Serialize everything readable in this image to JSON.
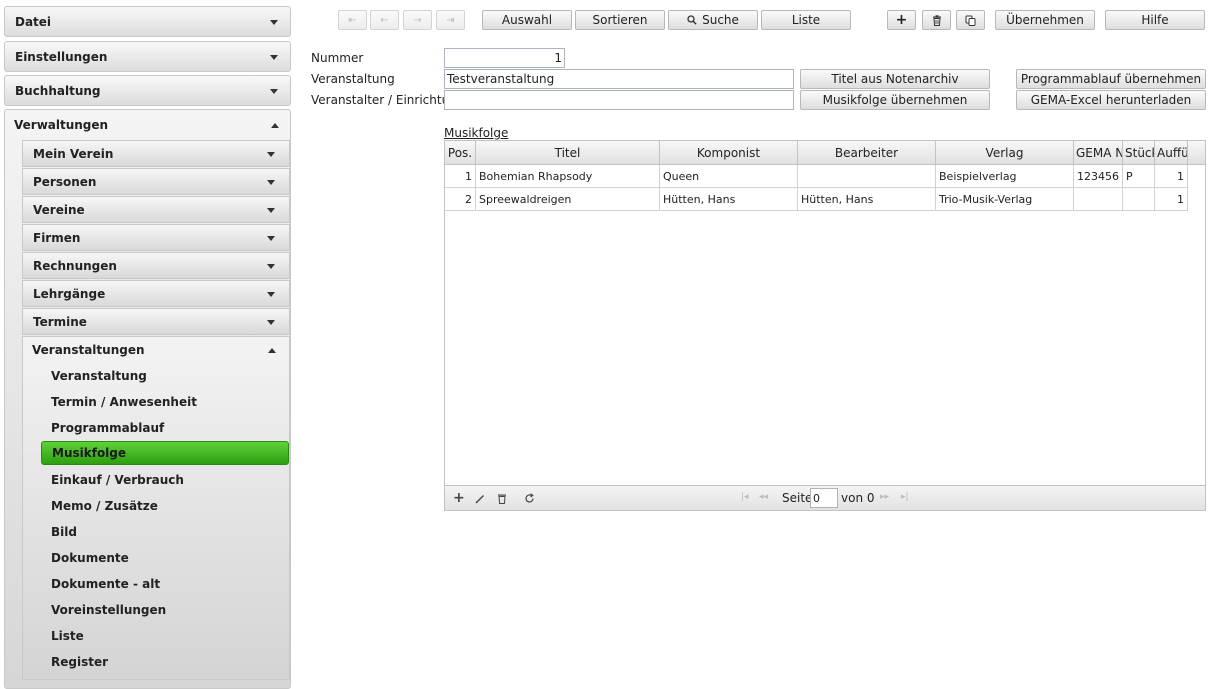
{
  "sidebar": {
    "top": [
      {
        "label": "Datei"
      },
      {
        "label": "Einstellungen"
      },
      {
        "label": "Buchhaltung"
      },
      {
        "label": "Verwaltungen"
      }
    ],
    "verwaltungen_items": [
      {
        "label": "Mein Verein"
      },
      {
        "label": "Personen"
      },
      {
        "label": "Vereine"
      },
      {
        "label": "Firmen"
      },
      {
        "label": "Rechnungen"
      },
      {
        "label": "Lehrgänge"
      },
      {
        "label": "Termine"
      },
      {
        "label": "Veranstaltungen"
      }
    ],
    "veranstaltungen_items": [
      {
        "label": "Veranstaltung"
      },
      {
        "label": "Termin / Anwesenheit"
      },
      {
        "label": "Programmablauf"
      },
      {
        "label": "Musikfolge"
      },
      {
        "label": "Einkauf / Verbrauch"
      },
      {
        "label": "Memo / Zusätze"
      },
      {
        "label": "Bild"
      },
      {
        "label": "Dokumente"
      },
      {
        "label": "Dokumente - alt"
      },
      {
        "label": "Voreinstellungen"
      },
      {
        "label": "Liste"
      },
      {
        "label": "Register"
      }
    ],
    "active_item": "Musikfolge",
    "active_color": "#3fb31f"
  },
  "toolbar": {
    "nav": {
      "first": "⇤",
      "prev": "←",
      "next": "→",
      "last": "⇥"
    },
    "auswahl": "Auswahl",
    "sortieren": "Sortieren",
    "suche": "Suche",
    "liste": "Liste",
    "add": "+",
    "uebernehmen": "Übernehmen",
    "hilfe": "Hilfe"
  },
  "form": {
    "nummer_label": "Nummer",
    "nummer_value": "1",
    "veranstaltung_label": "Veranstaltung",
    "veranstaltung_value": "Testveranstaltung",
    "veranstalter_label": "Veranstalter / Einrichtung",
    "veranstalter_value": "",
    "titel_notenarchiv": "Titel aus Notenarchiv",
    "musikfolge_uebernehmen": "Musikfolge übernehmen",
    "programmablauf_uebernehmen": "Programmablauf übernehmen",
    "gema_excel": "GEMA-Excel herunterladen"
  },
  "grid": {
    "title": "Musikfolge",
    "columns": [
      "Pos.",
      "Titel",
      "Komponist",
      "Bearbeiter",
      "Verlag",
      "GEMA N",
      "Stück",
      "Auffü"
    ],
    "rows": [
      {
        "pos": "1",
        "titel": "Bohemian Rhapsody",
        "komponist": "Queen",
        "bearbeiter": "",
        "verlag": "Beispielverlag",
        "gema": "123456",
        "stueck": "P",
        "auff": "1"
      },
      {
        "pos": "2",
        "titel": "Spreewaldreigen",
        "komponist": "Hütten, Hans",
        "bearbeiter": "Hütten, Hans",
        "verlag": "Trio-Musik-Verlag",
        "gema": "",
        "stueck": "",
        "auff": "1"
      }
    ],
    "footer": {
      "seite_label": "Seite",
      "seite_value": "0",
      "von_label": "von 0"
    }
  }
}
